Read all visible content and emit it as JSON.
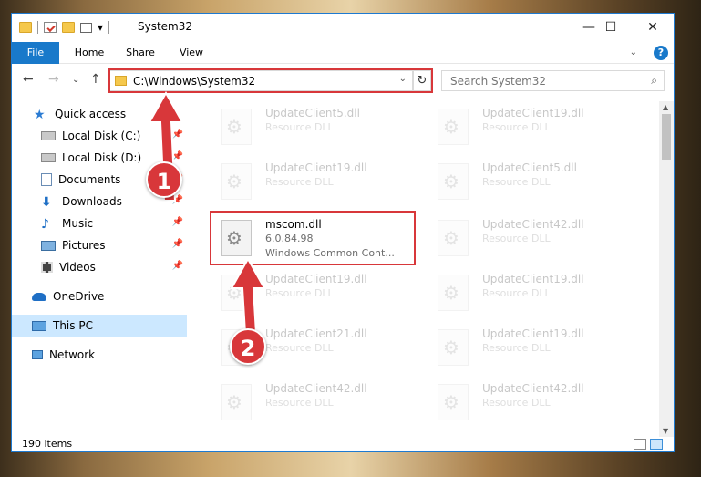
{
  "window": {
    "title": "System32"
  },
  "quick_access_toolbar": {
    "dropdown_glyph": "▾"
  },
  "ribbon": {
    "tabs": [
      "File",
      "Home",
      "Share",
      "View"
    ],
    "help_label": "?"
  },
  "window_controls": {
    "minimize": "—",
    "maximize": "☐",
    "close": "✕"
  },
  "address_bar": {
    "path": "C:\\Windows\\System32"
  },
  "search": {
    "placeholder": "Search System32"
  },
  "sidebar": {
    "items": [
      {
        "label": "Quick access",
        "icon": "star-icon",
        "pinned": false
      },
      {
        "label": "Local Disk (C:)",
        "icon": "drive-icon",
        "pinned": true
      },
      {
        "label": "Local Disk (D:)",
        "icon": "drive-icon",
        "pinned": true
      },
      {
        "label": "Documents",
        "icon": "document-icon",
        "pinned": true
      },
      {
        "label": "Downloads",
        "icon": "download-icon",
        "pinned": true
      },
      {
        "label": "Music",
        "icon": "music-icon",
        "pinned": true
      },
      {
        "label": "Pictures",
        "icon": "picture-icon",
        "pinned": true
      },
      {
        "label": "Videos",
        "icon": "video-icon",
        "pinned": true
      },
      {
        "label": "OneDrive",
        "icon": "cloud-icon",
        "pinned": false
      },
      {
        "label": "This PC",
        "icon": "computer-icon",
        "pinned": false,
        "selected": true
      },
      {
        "label": "Network",
        "icon": "network-icon",
        "pinned": false
      }
    ]
  },
  "files": {
    "left": [
      {
        "name": "UpdateClient5.dll",
        "type": "Resource DLL"
      },
      {
        "name": "UpdateClient19.dll",
        "type": "Resource DLL"
      },
      {
        "name": "mscom.dll",
        "version": "6.0.84.98",
        "description": "Windows Common Cont...",
        "highlighted": true
      },
      {
        "name": "UpdateClient19.dll",
        "type": "Resource DLL"
      },
      {
        "name": "UpdateClient21.dll",
        "type": "Resource DLL"
      },
      {
        "name": "UpdateClient42.dll",
        "type": "Resource DLL"
      }
    ],
    "right": [
      {
        "name": "UpdateClient19.dll",
        "type": "Resource DLL"
      },
      {
        "name": "UpdateClient5.dll",
        "type": "Resource DLL"
      },
      {
        "name": "UpdateClient42.dll",
        "type": "Resource DLL"
      },
      {
        "name": "UpdateClient19.dll",
        "type": "Resource DLL"
      },
      {
        "name": "UpdateClient19.dll",
        "type": "Resource DLL"
      },
      {
        "name": "UpdateClient42.dll",
        "type": "Resource DLL"
      }
    ]
  },
  "status_bar": {
    "item_count": "190 items"
  },
  "annotations": {
    "step1": "1",
    "step2": "2",
    "color": "#d8373a"
  }
}
